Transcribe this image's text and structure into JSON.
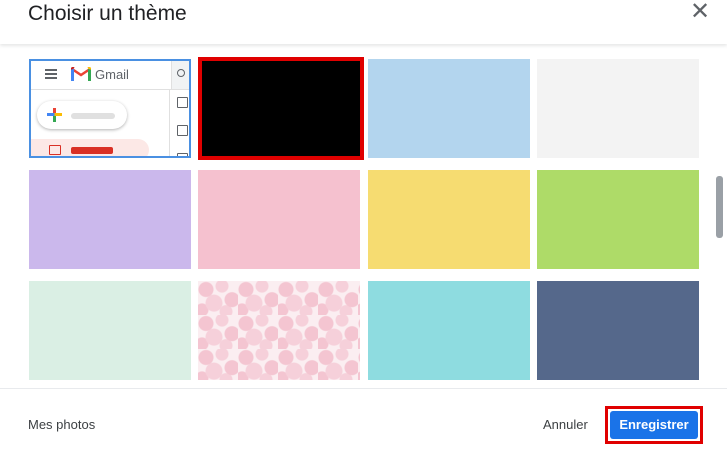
{
  "dialog": {
    "title": "Choisir un thème",
    "close_label": "✕"
  },
  "preview": {
    "app_name": "Gmail"
  },
  "themes": [
    {
      "name": "default-preview"
    },
    {
      "name": "black",
      "color": "#000000",
      "selected": true
    },
    {
      "name": "light-blue",
      "color": "#b3d5ee"
    },
    {
      "name": "light-gray",
      "color": "#f3f3f3"
    },
    {
      "name": "lavender",
      "color": "#cbb8ec"
    },
    {
      "name": "pink",
      "color": "#f5c1cf"
    },
    {
      "name": "yellow",
      "color": "#f6dc71"
    },
    {
      "name": "lime-green",
      "color": "#aedb68"
    },
    {
      "name": "mint",
      "color": "#daefe4"
    },
    {
      "name": "cherry-blossom"
    },
    {
      "name": "turquoise",
      "color": "#8edce0"
    },
    {
      "name": "slate-blue",
      "color": "#55688b"
    }
  ],
  "footer": {
    "my_photos": "Mes photos",
    "cancel": "Annuler",
    "save": "Enregistrer"
  }
}
